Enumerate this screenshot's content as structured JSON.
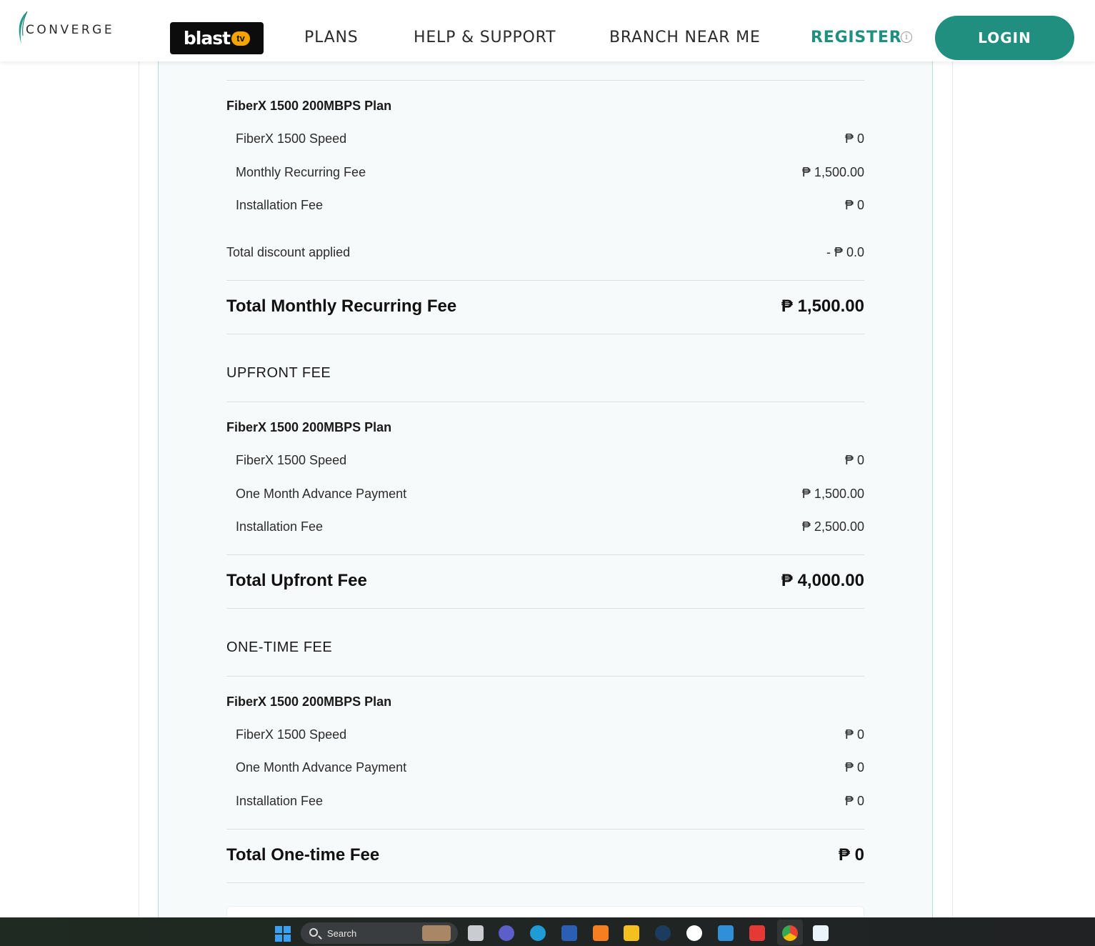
{
  "header": {
    "logo_text": "CONVERGE",
    "blast_word": "blast",
    "blast_tv": "tv",
    "nav": [
      "PLANS",
      "HELP & SUPPORT",
      "BRANCH NEAR ME"
    ],
    "register": "REGISTER",
    "login": "LOGIN",
    "accent_color": "#218f80"
  },
  "monthly": {
    "plan_title": "FiberX 1500 200MBPS Plan",
    "items": [
      {
        "label": "FiberX 1500 Speed",
        "value": "₱ 0"
      },
      {
        "label": "Monthly Recurring Fee",
        "value": "₱ 1,500.00"
      },
      {
        "label": "Installation Fee",
        "value": "₱ 0"
      }
    ],
    "discount_label": "Total discount applied",
    "discount_value": "- ₱ 0.0",
    "total_label": "Total Monthly Recurring Fee",
    "total_value": "₱ 1,500.00"
  },
  "upfront": {
    "section_title": "UPFRONT FEE",
    "plan_title": "FiberX 1500 200MBPS Plan",
    "items": [
      {
        "label": "FiberX 1500 Speed",
        "value": "₱ 0"
      },
      {
        "label": "One Month Advance Payment",
        "value": "₱ 1,500.00"
      },
      {
        "label": "Installation Fee",
        "value": "₱ 2,500.00"
      }
    ],
    "total_label": "Total Upfront Fee",
    "total_value": "₱ 4,000.00"
  },
  "onetime": {
    "section_title": "ONE-TIME FEE",
    "plan_title": "FiberX 1500 200MBPS Plan",
    "items": [
      {
        "label": "FiberX 1500 Speed",
        "value": "₱ 0"
      },
      {
        "label": "One Month Advance Payment",
        "value": "₱ 0"
      },
      {
        "label": "Installation Fee",
        "value": "₱ 0"
      }
    ],
    "total_label": "Total One-time Fee",
    "total_value": "₱ 0"
  },
  "taskbar": {
    "search_placeholder": "Search",
    "apps": [
      "task-view",
      "meet",
      "edge",
      "word",
      "xampp",
      "file-explorer",
      "steam",
      "anydesk",
      "vscode",
      "git-app",
      "chrome",
      "notepad"
    ]
  }
}
